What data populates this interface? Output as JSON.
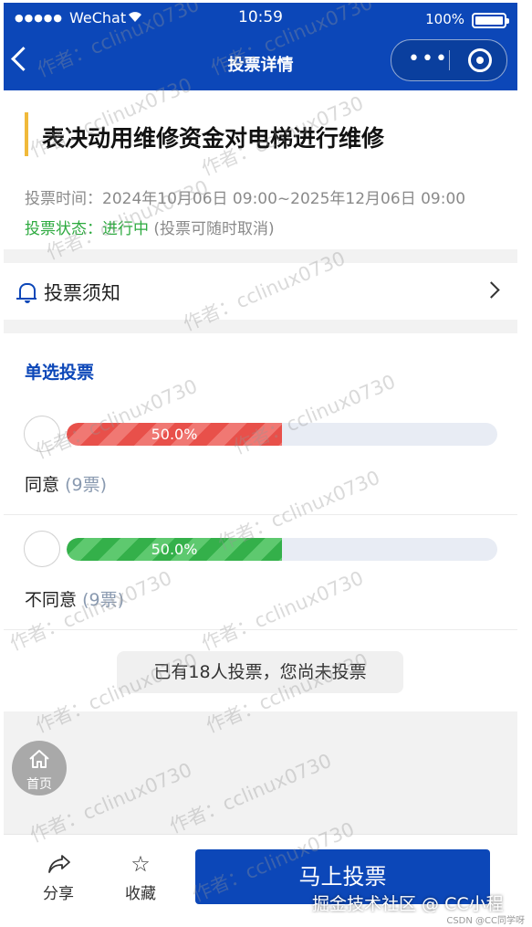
{
  "status_bar": {
    "signal": "●●●●●",
    "carrier": "WeChat",
    "time": "10:59",
    "battery": "100%"
  },
  "nav": {
    "title": "投票详情"
  },
  "vote": {
    "title": "表决动用维修资金对电梯进行维修",
    "time_label": "投票时间：",
    "time_value": "2024年10月06日 09:00~2025年12月06日 09:00",
    "status_label": "投票状态：",
    "status_value": "进行中",
    "status_note": "(投票可随时取消)"
  },
  "notice": {
    "label": "投票须知"
  },
  "options_section": {
    "title": "单选投票",
    "options": [
      {
        "label": "同意",
        "count": "(9票)",
        "percent_text": "50.0%",
        "fraction": 0.5,
        "color": "#e8504a"
      },
      {
        "label": "不同意",
        "count": "(9票)",
        "percent_text": "50.0%",
        "fraction": 0.5,
        "color": "#34b04a"
      }
    ],
    "summary": "已有18人投票，您尚未投票"
  },
  "home_float": {
    "label": "首页"
  },
  "bottom_bar": {
    "share": "分享",
    "favorite": "收藏",
    "vote_button": "马上投票"
  },
  "watermark": {
    "text": "作者：cclinux0730"
  },
  "footer": {
    "caption": "掘金技术社区 @ CC小程序",
    "small": "CSDN @CC同学呀"
  },
  "colors": {
    "brand": "#0c47b8",
    "accent": "#f0b93a",
    "status_green": "#2daa3f"
  }
}
